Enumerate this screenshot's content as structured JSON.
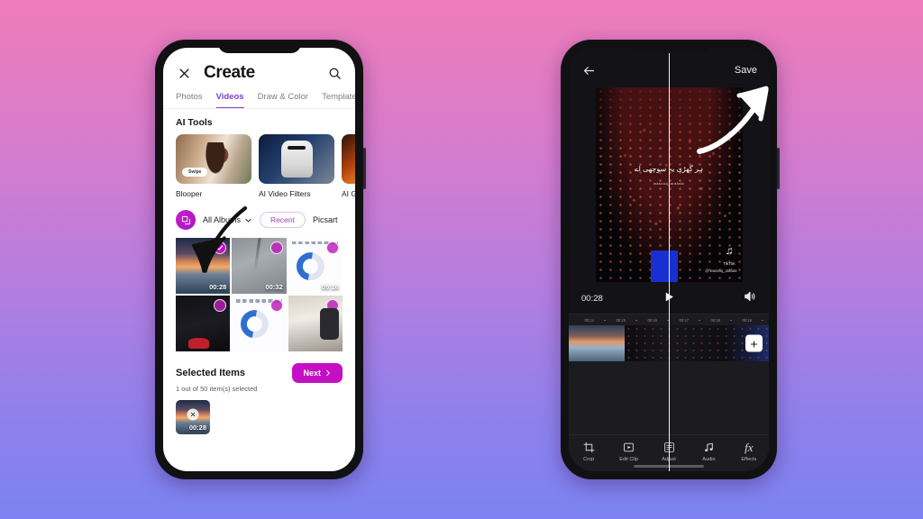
{
  "background": {
    "gradient_from": "#ee7cb9",
    "gradient_to": "#7b82f2"
  },
  "accent": {
    "purple": "#7b42d6",
    "magenta": "#c40fc4",
    "pink_chip": "#a33fc3"
  },
  "left_phone": {
    "header": {
      "close_icon": "close-icon",
      "title": "Create",
      "search_icon": "search-icon"
    },
    "tabs": [
      {
        "label": "Photos",
        "active": false
      },
      {
        "label": "Videos",
        "active": true
      },
      {
        "label": "Draw & Color",
        "active": false
      },
      {
        "label": "Templates",
        "active": false
      }
    ],
    "section_title": "AI Tools",
    "tools": [
      {
        "label": "Blooper",
        "badge": "Swipe"
      },
      {
        "label": "AI Video Filters",
        "badge": ""
      },
      {
        "label": "AI GIF",
        "badge": ""
      }
    ],
    "album_bar": {
      "fab_icon": "multi-select-icon",
      "album_label": "All Albums",
      "chevron_icon": "chevron-down-icon",
      "chip_label": "Recent",
      "picsart_label": "Picsart"
    },
    "grid": [
      {
        "duration": "00:28",
        "selected": true
      },
      {
        "duration": "00:32",
        "selected": false
      },
      {
        "duration": "05:16",
        "selected": false
      },
      {
        "duration": "",
        "selected": false
      },
      {
        "duration": "",
        "selected": false
      },
      {
        "duration": "",
        "selected": false
      }
    ],
    "selected_items": {
      "title": "Selected Items",
      "subtitle": "1 out of 50 item(s) selected",
      "next_label": "Next",
      "next_chevron": "chevron-right-icon",
      "thumbs": [
        {
          "duration": "00:28",
          "remove_icon": "close-icon"
        }
      ]
    }
  },
  "right_phone": {
    "header": {
      "back_icon": "back-arrow-icon",
      "save_label": "Save"
    },
    "preview": {
      "caption": "ہر گھڑی یہ سوچھی اے",
      "handle": "wasouq_arafata",
      "watermark_logo": "tiktok-icon",
      "watermark_name": "TikTok",
      "watermark_user": "@ wasooq_arafata"
    },
    "controls": {
      "time": "00:28",
      "play_icon": "play-icon",
      "volume_icon": "volume-icon"
    },
    "ruler": [
      "00:14",
      "00:15",
      "00:16",
      "00:17",
      "00:18",
      "00:19"
    ],
    "timeline": {
      "add_icon": "plus-icon"
    },
    "tools": [
      {
        "label": "Crop",
        "icon": "crop-icon"
      },
      {
        "label": "Edit Clip",
        "icon": "edit-clip-icon"
      },
      {
        "label": "Adjust",
        "icon": "adjust-icon"
      },
      {
        "label": "Audio",
        "icon": "music-note-icon"
      },
      {
        "label": "Effects",
        "icon": "fx-icon"
      }
    ]
  }
}
